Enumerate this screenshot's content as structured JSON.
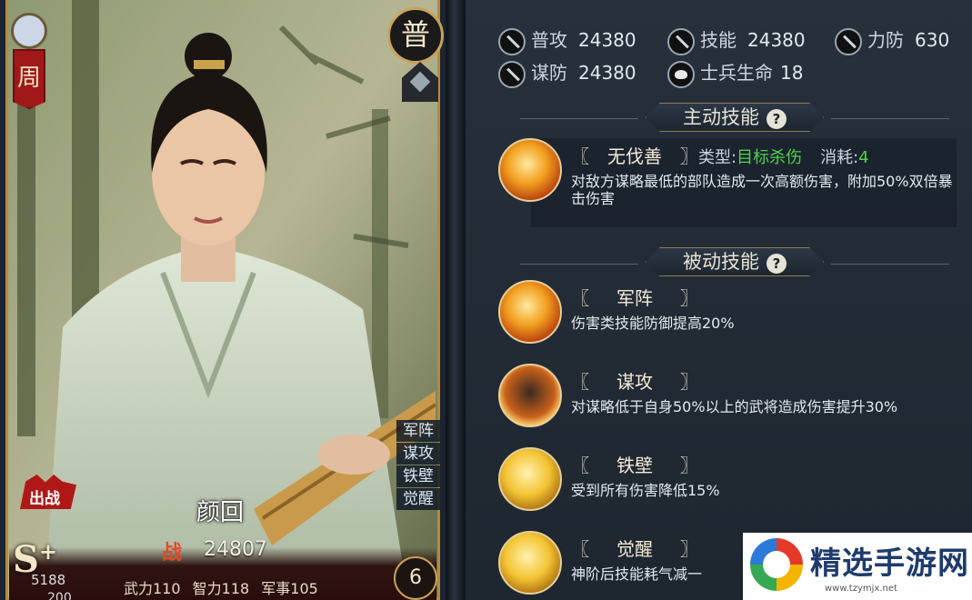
{
  "hero": {
    "grade": "普",
    "faction": "周",
    "name": "颜回",
    "star_rank": "S",
    "star_plus": "+",
    "power_label": "战",
    "power": "24807",
    "stats": [
      "武力110",
      "智力118",
      "军事105"
    ],
    "level": "6",
    "xp_current": "5188",
    "xp_max": "200",
    "deploy_label": "出战",
    "side_skills": [
      "军阵",
      "谋攻",
      "铁壁",
      "觉醒"
    ]
  },
  "attributes": [
    {
      "name": "普攻",
      "value": "24380",
      "icon": "sword-icon"
    },
    {
      "name": "技能",
      "value": "24380",
      "icon": "sword-icon"
    },
    {
      "name": "力防",
      "value": "630",
      "icon": "shield-sword-icon"
    },
    {
      "name": "谋防",
      "value": "24380",
      "icon": "sword-icon"
    },
    {
      "name": "士兵生命",
      "value": "18",
      "icon": "heart-icon"
    }
  ],
  "active_section": {
    "title": "主动技能",
    "help": "?"
  },
  "passive_section": {
    "title": "被动技能",
    "help": "?"
  },
  "active_skill": {
    "name": "无伐善",
    "type_label": "类型:",
    "type_value": "目标杀伤",
    "cost_label": "消耗:",
    "cost_value": "4",
    "desc": "对敌方谋略最低的部队造成一次高额伤害，附加50%双倍暴击伤害"
  },
  "passive_skills": [
    {
      "name": "军阵",
      "desc": "伤害类技能防御提高20%",
      "icon": "army-formation-icon"
    },
    {
      "name": "谋攻",
      "desc": "对谋略低于自身50%以上的武将造成伤害提升30%",
      "icon": "arrow-strike-icon"
    },
    {
      "name": "铁壁",
      "desc": "受到所有伤害降低15%",
      "icon": "shield-icon"
    },
    {
      "name": "觉醒",
      "desc": "神阶后技能耗气减一",
      "icon": "meditation-icon"
    }
  ],
  "watermark": {
    "title": "精选手游网",
    "url": "www.tzymjx.net"
  }
}
